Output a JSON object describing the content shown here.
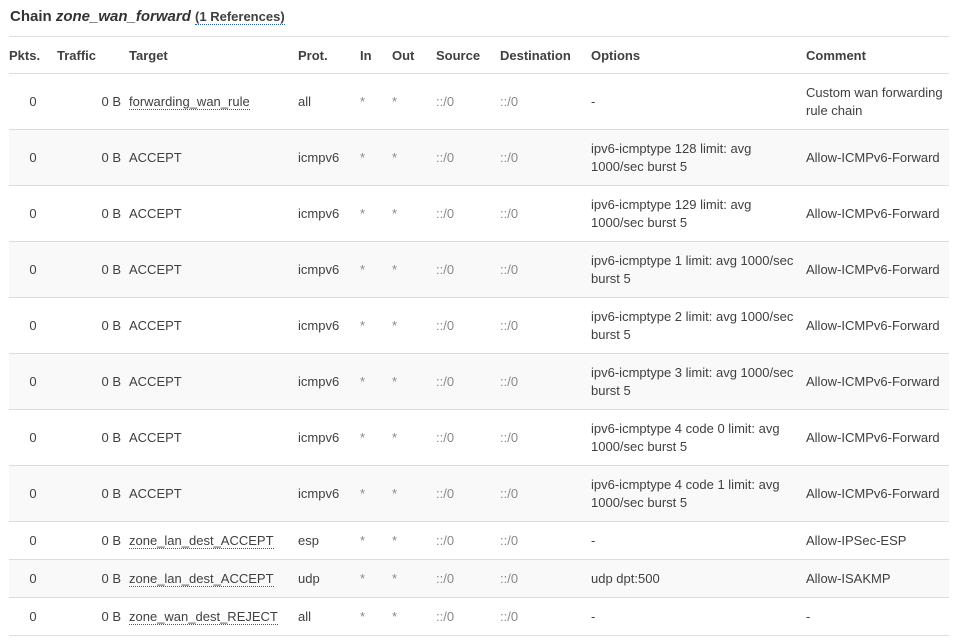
{
  "chain": {
    "prefix": "Chain",
    "name": "zone_wan_forward",
    "references": "(1 References)"
  },
  "columns": [
    "Pkts.",
    "Traffic",
    "Target",
    "Prot.",
    "In",
    "Out",
    "Source",
    "Destination",
    "Options",
    "Comment"
  ],
  "rows": [
    {
      "pkts": "0",
      "traffic": "0 B",
      "target": "forwarding_wan_rule",
      "target_link": true,
      "prot": "all",
      "in": "*",
      "out": "*",
      "source": "::/0",
      "destination": "::/0",
      "options": "-",
      "comment": "Custom wan forwarding rule chain"
    },
    {
      "pkts": "0",
      "traffic": "0 B",
      "target": "ACCEPT",
      "target_link": false,
      "prot": "icmpv6",
      "in": "*",
      "out": "*",
      "source": "::/0",
      "destination": "::/0",
      "options": "ipv6-icmptype 128 limit: avg 1000/sec burst 5",
      "comment": "Allow-ICMPv6-Forward"
    },
    {
      "pkts": "0",
      "traffic": "0 B",
      "target": "ACCEPT",
      "target_link": false,
      "prot": "icmpv6",
      "in": "*",
      "out": "*",
      "source": "::/0",
      "destination": "::/0",
      "options": "ipv6-icmptype 129 limit: avg 1000/sec burst 5",
      "comment": "Allow-ICMPv6-Forward"
    },
    {
      "pkts": "0",
      "traffic": "0 B",
      "target": "ACCEPT",
      "target_link": false,
      "prot": "icmpv6",
      "in": "*",
      "out": "*",
      "source": "::/0",
      "destination": "::/0",
      "options": "ipv6-icmptype 1 limit: avg 1000/sec burst 5",
      "comment": "Allow-ICMPv6-Forward"
    },
    {
      "pkts": "0",
      "traffic": "0 B",
      "target": "ACCEPT",
      "target_link": false,
      "prot": "icmpv6",
      "in": "*",
      "out": "*",
      "source": "::/0",
      "destination": "::/0",
      "options": "ipv6-icmptype 2 limit: avg 1000/sec burst 5",
      "comment": "Allow-ICMPv6-Forward"
    },
    {
      "pkts": "0",
      "traffic": "0 B",
      "target": "ACCEPT",
      "target_link": false,
      "prot": "icmpv6",
      "in": "*",
      "out": "*",
      "source": "::/0",
      "destination": "::/0",
      "options": "ipv6-icmptype 3 limit: avg 1000/sec burst 5",
      "comment": "Allow-ICMPv6-Forward"
    },
    {
      "pkts": "0",
      "traffic": "0 B",
      "target": "ACCEPT",
      "target_link": false,
      "prot": "icmpv6",
      "in": "*",
      "out": "*",
      "source": "::/0",
      "destination": "::/0",
      "options": "ipv6-icmptype 4 code 0 limit: avg 1000/sec burst 5",
      "comment": "Allow-ICMPv6-Forward"
    },
    {
      "pkts": "0",
      "traffic": "0 B",
      "target": "ACCEPT",
      "target_link": false,
      "prot": "icmpv6",
      "in": "*",
      "out": "*",
      "source": "::/0",
      "destination": "::/0",
      "options": "ipv6-icmptype 4 code 1 limit: avg 1000/sec burst 5",
      "comment": "Allow-ICMPv6-Forward"
    },
    {
      "pkts": "0",
      "traffic": "0 B",
      "target": "zone_lan_dest_ACCEPT",
      "target_link": true,
      "prot": "esp",
      "in": "*",
      "out": "*",
      "source": "::/0",
      "destination": "::/0",
      "options": "-",
      "comment": "Allow-IPSec-ESP"
    },
    {
      "pkts": "0",
      "traffic": "0 B",
      "target": "zone_lan_dest_ACCEPT",
      "target_link": true,
      "prot": "udp",
      "in": "*",
      "out": "*",
      "source": "::/0",
      "destination": "::/0",
      "options": "udp dpt:500",
      "comment": "Allow-ISAKMP"
    },
    {
      "pkts": "0",
      "traffic": "0 B",
      "target": "zone_wan_dest_REJECT",
      "target_link": true,
      "prot": "all",
      "in": "*",
      "out": "*",
      "source": "::/0",
      "destination": "::/0",
      "options": "-",
      "comment": "-"
    }
  ]
}
